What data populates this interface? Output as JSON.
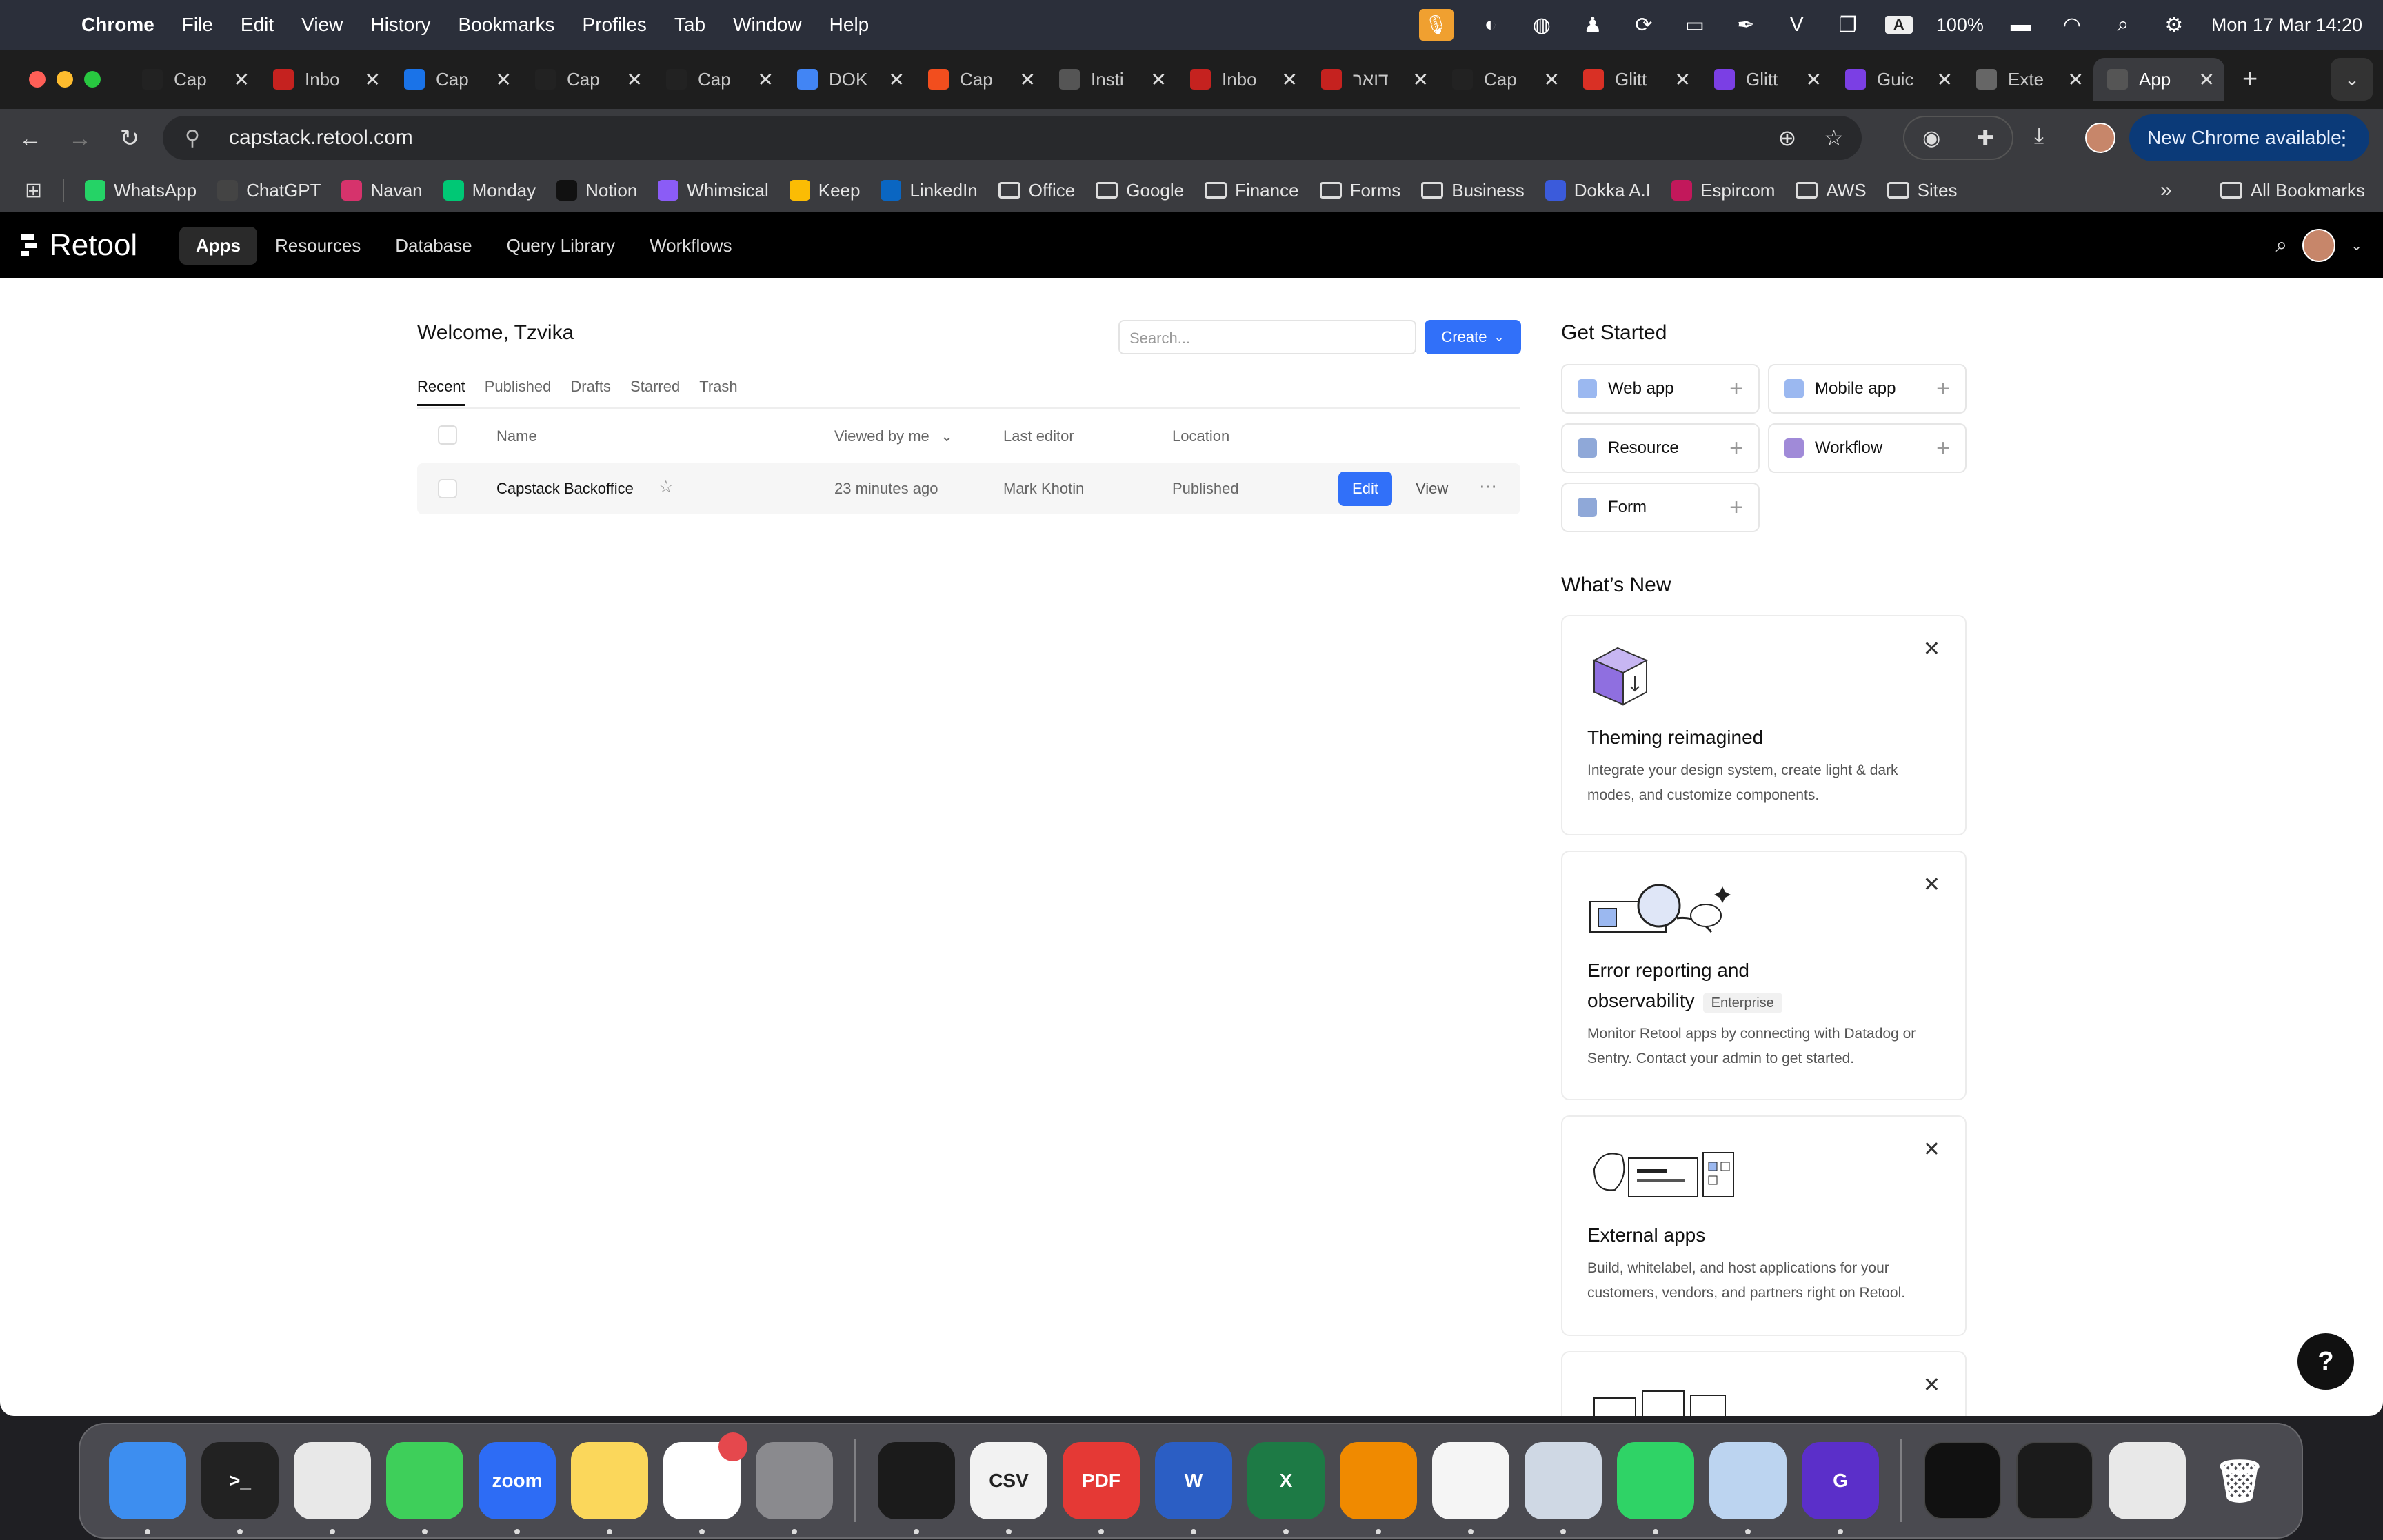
{
  "menubar": {
    "app_name": "Chrome",
    "menus": [
      "File",
      "Edit",
      "View",
      "History",
      "Bookmarks",
      "Profiles",
      "Tab",
      "Window",
      "Help"
    ],
    "battery": "100%",
    "datetime": "Mon 17 Mar  14:20"
  },
  "tabs": [
    {
      "label": "Cap",
      "icon": "layers",
      "color": "#222"
    },
    {
      "label": "Inbo",
      "icon": "gmail",
      "color": "#c5221f"
    },
    {
      "label": "Cap",
      "icon": "calendar",
      "color": "#1a73e8"
    },
    {
      "label": "Cap",
      "icon": "layers",
      "color": "#222"
    },
    {
      "label": "Cap",
      "icon": "layers",
      "color": "#222"
    },
    {
      "label": "DOK",
      "icon": "docs",
      "color": "#4285f4"
    },
    {
      "label": "Cap",
      "icon": "figma",
      "color": "#f24e1e"
    },
    {
      "label": "Insti",
      "icon": "retool",
      "color": "#555"
    },
    {
      "label": "Inbo",
      "icon": "gmail",
      "color": "#c5221f"
    },
    {
      "label": "דואר",
      "icon": "gmail",
      "color": "#c5221f"
    },
    {
      "label": "Cap",
      "icon": "layers",
      "color": "#222"
    },
    {
      "label": "Glitt",
      "icon": "image",
      "color": "#d93025"
    },
    {
      "label": "Glitt",
      "icon": "glitter",
      "color": "#7b3fe4"
    },
    {
      "label": "Guic",
      "icon": "glitter",
      "color": "#7b3fe4"
    },
    {
      "label": "Exte",
      "icon": "puzzle",
      "color": "#666"
    },
    {
      "label": "App",
      "icon": "retool",
      "color": "#555",
      "active": true
    }
  ],
  "toolbar": {
    "url": "capstack.retool.com",
    "new_chrome": "New Chrome available"
  },
  "bookmarks": [
    {
      "label": "WhatsApp",
      "icon": "whatsapp",
      "color": "#25d366"
    },
    {
      "label": "ChatGPT",
      "icon": "openai",
      "color": "#444"
    },
    {
      "label": "Navan",
      "icon": "navan",
      "color": "#d6336c"
    },
    {
      "label": "Monday",
      "icon": "monday",
      "color": "#00c875"
    },
    {
      "label": "Notion",
      "icon": "notion",
      "color": "#111"
    },
    {
      "label": "Whimsical",
      "icon": "whimsical",
      "color": "#8b5cf6"
    },
    {
      "label": "Keep",
      "icon": "keep",
      "color": "#fbbc04"
    },
    {
      "label": "LinkedIn",
      "icon": "linkedin",
      "color": "#0a66c2"
    },
    {
      "label": "Office",
      "icon": "folder",
      "color": ""
    },
    {
      "label": "Google",
      "icon": "folder",
      "color": ""
    },
    {
      "label": "Finance",
      "icon": "folder",
      "color": ""
    },
    {
      "label": "Forms",
      "icon": "folder",
      "color": ""
    },
    {
      "label": "Business",
      "icon": "folder",
      "color": ""
    },
    {
      "label": "Dokka A.I",
      "icon": "dokka",
      "color": "#3b5bdb"
    },
    {
      "label": "Espircom",
      "icon": "espircom",
      "color": "#c2185b"
    },
    {
      "label": "AWS",
      "icon": "folder",
      "color": ""
    },
    {
      "label": "Sites",
      "icon": "folder",
      "color": ""
    }
  ],
  "all_bookmarks": "All Bookmarks",
  "retool": {
    "logo": "Retool",
    "nav": [
      "Apps",
      "Resources",
      "Database",
      "Query Library",
      "Workflows"
    ],
    "active_nav": "Apps"
  },
  "main": {
    "welcome": "Welcome, Tzvika",
    "search_placeholder": "Search...",
    "create_label": "Create",
    "tabs": [
      "Recent",
      "Published",
      "Drafts",
      "Starred",
      "Trash"
    ],
    "active_tab": "Recent",
    "columns": {
      "name": "Name",
      "viewed": "Viewed by me",
      "editor": "Last editor",
      "location": "Location"
    },
    "rows": [
      {
        "name": "Capstack Backoffice",
        "viewed": "23 minutes ago",
        "editor": "Mark Khotin",
        "location": "Published",
        "edit": "Edit",
        "view": "View"
      }
    ]
  },
  "get_started": {
    "title": "Get Started",
    "items": [
      {
        "label": "Web app",
        "icon": "monitor",
        "color": "#9bb8f0"
      },
      {
        "label": "Mobile app",
        "icon": "phone",
        "color": "#9bb8f0"
      },
      {
        "label": "Resource",
        "icon": "database",
        "color": "#8fa8d8"
      },
      {
        "label": "Workflow",
        "icon": "workflow",
        "color": "#a08ad8"
      },
      {
        "label": "Form",
        "icon": "list",
        "color": "#8fa8d8"
      }
    ]
  },
  "whats_new": {
    "title": "What’s New",
    "cards": [
      {
        "title": "Theming reimagined",
        "desc": "Integrate your design system, create light & dark modes, and customize components."
      },
      {
        "title": "Error reporting and observability",
        "badge": "Enterprise",
        "desc": "Monitor Retool apps by connecting with Datadog or Sentry. Contact your admin to get started."
      },
      {
        "title": "External apps",
        "desc": "Build, whitelabel, and host applications for your customers, vendors, and partners right on Retool."
      }
    ]
  },
  "dock": [
    {
      "name": "finder",
      "label": "",
      "color": "#3d8ef0"
    },
    {
      "name": "terminal",
      "label": ">_",
      "color": "#222"
    },
    {
      "name": "chrome",
      "label": "",
      "color": "#e8e8e8"
    },
    {
      "name": "messages",
      "label": "",
      "color": "#3ecf5a"
    },
    {
      "name": "zoom",
      "label": "zoom",
      "color": "#2d6cf5"
    },
    {
      "name": "notes",
      "label": "",
      "color": "#fbd75b"
    },
    {
      "name": "slack",
      "label": "",
      "color": "#ffffff"
    },
    {
      "name": "system-settings",
      "label": "",
      "color": "#8a8a8e"
    },
    {
      "name": "activity-monitor",
      "label": "",
      "color": "#1b1b1b"
    },
    {
      "name": "csv-editor",
      "label": "CSV",
      "color": "#f2f2f2"
    },
    {
      "name": "pdf-expert",
      "label": "PDF",
      "color": "#e53935"
    },
    {
      "name": "word",
      "label": "W",
      "color": "#2b5ec4"
    },
    {
      "name": "excel",
      "label": "X",
      "color": "#1d7a45"
    },
    {
      "name": "vlc",
      "label": "",
      "color": "#f08a00"
    },
    {
      "name": "textedit",
      "label": "",
      "color": "#f5f5f5"
    },
    {
      "name": "preview",
      "label": "",
      "color": "#cfd8e4"
    },
    {
      "name": "whatsapp",
      "label": "",
      "color": "#2fd366"
    },
    {
      "name": "1password",
      "label": "",
      "color": "#bcd4f0"
    },
    {
      "name": "glitter",
      "label": "G",
      "color": "#5b2fc9"
    }
  ]
}
